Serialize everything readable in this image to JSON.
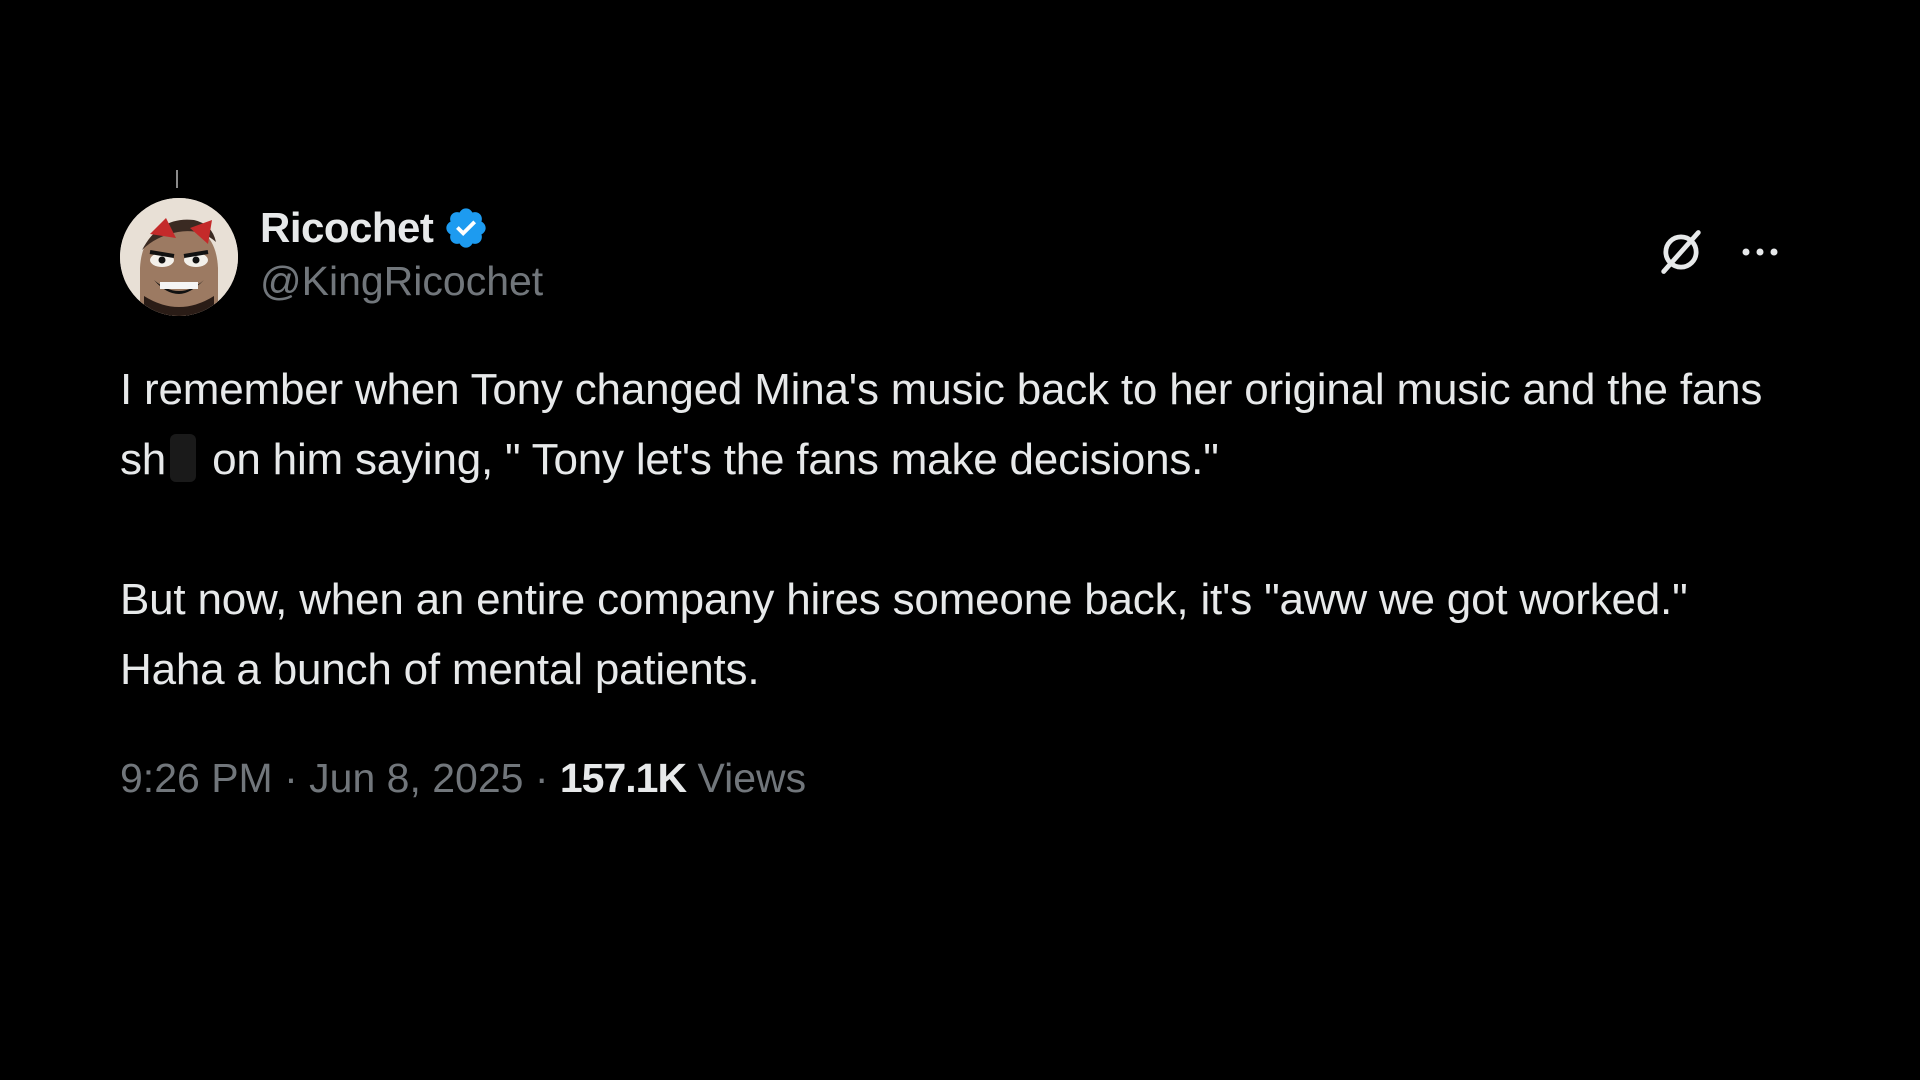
{
  "tweet": {
    "author": {
      "display_name": "Ricochet",
      "handle": "@KingRicochet",
      "verified": true,
      "avatar_icon": "avatar-icon",
      "verified_icon": "verified-badge-icon"
    },
    "actions": {
      "grok_icon": "grok-icon",
      "more_icon": "more-icon"
    },
    "body": {
      "p1_part1": "I remember when Tony changed Mina's music back to her original music and the fans sh",
      "p1_part2": " on him saying, \" Tony let's the fans make decisions.\"",
      "p2": "But now, when an entire company hires someone back, it's \"aww we got worked.\" Haha a bunch of mental patients."
    },
    "meta": {
      "time": "9:26 PM",
      "separator": " · ",
      "date": "Jun 8, 2025",
      "views_count": "157.1K",
      "views_label": "Views"
    },
    "colors": {
      "background": "#000000",
      "primary_text": "#e7e9ea",
      "secondary_text": "#71767b",
      "verified_blue": "#1d9bf0"
    }
  }
}
